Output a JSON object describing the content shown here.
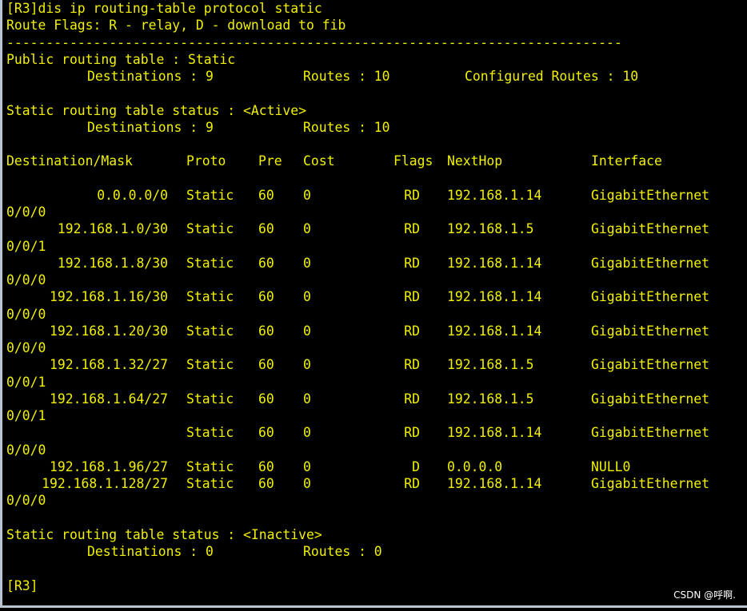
{
  "terminal": {
    "command_line": "[R3]dis ip routing-table protocol static",
    "flags_legend": "Route Flags: R - relay, D - download to fib",
    "separator": "------------------------------------------------------------------------------",
    "public_title": "Public routing table : Static",
    "public_summary": {
      "destinations_label": "Destinations : 9",
      "routes_label": "Routes : 10",
      "configured_label": "Configured Routes : 10"
    },
    "active_title": "Static routing table status : <Active>",
    "active_summary": {
      "destinations_label": "Destinations : 9",
      "routes_label": "Routes : 10"
    },
    "headers": {
      "destination": "Destination/Mask",
      "proto": "Proto",
      "pre": "Pre",
      "cost": "Cost",
      "flags": "Flags",
      "nexthop": "NextHop",
      "interface": "Interface"
    },
    "routes": [
      {
        "dest": "0.0.0.0/0",
        "proto": "Static",
        "pre": "60",
        "cost": "0",
        "flags": "RD",
        "nexthop": "192.168.1.14",
        "iface": "GigabitEthernet",
        "iface_cont": "0/0/0"
      },
      {
        "dest": "192.168.1.0/30",
        "proto": "Static",
        "pre": "60",
        "cost": "0",
        "flags": "RD",
        "nexthop": "192.168.1.5",
        "iface": "GigabitEthernet",
        "iface_cont": "0/0/1"
      },
      {
        "dest": "192.168.1.8/30",
        "proto": "Static",
        "pre": "60",
        "cost": "0",
        "flags": "RD",
        "nexthop": "192.168.1.14",
        "iface": "GigabitEthernet",
        "iface_cont": "0/0/0"
      },
      {
        "dest": "192.168.1.16/30",
        "proto": "Static",
        "pre": "60",
        "cost": "0",
        "flags": "RD",
        "nexthop": "192.168.1.14",
        "iface": "GigabitEthernet",
        "iface_cont": "0/0/0"
      },
      {
        "dest": "192.168.1.20/30",
        "proto": "Static",
        "pre": "60",
        "cost": "0",
        "flags": "RD",
        "nexthop": "192.168.1.14",
        "iface": "GigabitEthernet",
        "iface_cont": "0/0/0"
      },
      {
        "dest": "192.168.1.32/27",
        "proto": "Static",
        "pre": "60",
        "cost": "0",
        "flags": "RD",
        "nexthop": "192.168.1.5",
        "iface": "GigabitEthernet",
        "iface_cont": "0/0/1"
      },
      {
        "dest": "192.168.1.64/27",
        "proto": "Static",
        "pre": "60",
        "cost": "0",
        "flags": "RD",
        "nexthop": "192.168.1.5",
        "iface": "GigabitEthernet",
        "iface_cont": "0/0/1"
      },
      {
        "dest": "",
        "proto": "Static",
        "pre": "60",
        "cost": "0",
        "flags": "RD",
        "nexthop": "192.168.1.14",
        "iface": "GigabitEthernet",
        "iface_cont": "0/0/0"
      },
      {
        "dest": "192.168.1.96/27",
        "proto": "Static",
        "pre": "60",
        "cost": "0",
        "flags": "D",
        "nexthop": "0.0.0.0",
        "iface": "NULL0",
        "iface_cont": null
      },
      {
        "dest": "192.168.1.128/27",
        "proto": "Static",
        "pre": "60",
        "cost": "0",
        "flags": "RD",
        "nexthop": "192.168.1.14",
        "iface": "GigabitEthernet",
        "iface_cont": "0/0/0"
      }
    ],
    "inactive_title": "Static routing table status : <Inactive>",
    "inactive_summary": {
      "destinations_label": "Destinations : 0",
      "routes_label": "Routes : 0"
    },
    "prompt": "[R3]"
  },
  "watermark": "CSDN @呼啊.",
  "colors": {
    "background": "#000000",
    "text": "#f0f000",
    "frame": "#b9c4d4"
  }
}
